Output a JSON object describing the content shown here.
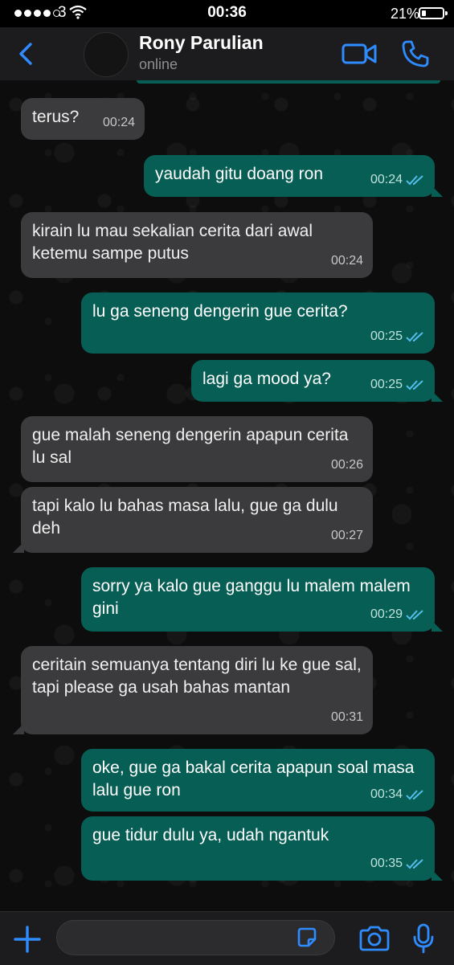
{
  "status_bar": {
    "carrier": "3",
    "time": "00:36",
    "battery_percent": "21%",
    "battery_level": 0.21,
    "signal_bars": 4
  },
  "header": {
    "contact_name": "Rony Parulian",
    "contact_status": "online"
  },
  "colors": {
    "accent": "#2f8cff",
    "outgoing_bubble": "#075e54",
    "incoming_bubble": "#3b3b3d",
    "read_ticks": "#53bdeb"
  },
  "messages": [
    {
      "direction": "in",
      "text": "terus?",
      "time": "00:24"
    },
    {
      "direction": "out",
      "text": "yaudah gitu doang ron",
      "time": "00:24",
      "status": "read"
    },
    {
      "direction": "in",
      "text": "kirain lu mau sekalian cerita dari awal ketemu sampe putus",
      "time": "00:24"
    },
    {
      "direction": "out",
      "text": "lu ga seneng dengerin gue cerita?",
      "time": "00:25",
      "status": "read"
    },
    {
      "direction": "out",
      "text": "lagi ga mood ya?",
      "time": "00:25",
      "status": "read"
    },
    {
      "direction": "in",
      "text": "gue malah seneng dengerin apapun cerita lu sal",
      "time": "00:26"
    },
    {
      "direction": "in",
      "text": "tapi kalo lu bahas masa lalu, gue ga dulu deh",
      "time": "00:27"
    },
    {
      "direction": "out",
      "text": "sorry ya kalo gue ganggu lu malem malem gini",
      "time": "00:29",
      "status": "read"
    },
    {
      "direction": "in",
      "text": "ceritain semuanya tentang diri lu ke gue sal, tapi please ga usah bahas mantan",
      "time": "00:31"
    },
    {
      "direction": "out",
      "text": "oke, gue ga bakal cerita apapun soal masa lalu gue ron",
      "time": "00:34",
      "status": "read"
    },
    {
      "direction": "out",
      "text": "gue tidur dulu ya, udah ngantuk",
      "time": "00:35",
      "status": "read"
    }
  ],
  "input": {
    "value": ""
  }
}
